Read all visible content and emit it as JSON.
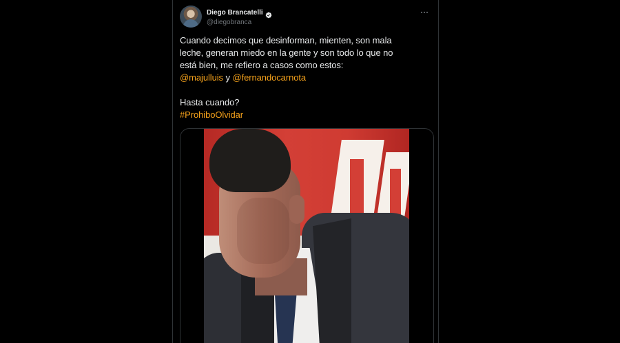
{
  "tweet": {
    "author": {
      "display_name": "Diego Brancatelli",
      "handle": "@diegobranca",
      "verified": true,
      "avatar_icon": "avatar-photo"
    },
    "more_icon": "more-horizontal-icon",
    "text_lines": [
      "Cuando decimos que desinforman, mienten, son mala",
      "leche, generan miedo en la gente y son todo lo que no",
      "está bien, me refiero a casos como estos:"
    ],
    "mentions": {
      "first": "@majulluis",
      "joiner": " y ",
      "second": "@fernandocarnota"
    },
    "question": "Hasta cuando?",
    "hashtag": "#ProhiboOlvidar",
    "media": {
      "type": "video-still",
      "description_label": "video"
    }
  },
  "colors": {
    "background": "#000000",
    "text": "#e7e9ea",
    "muted": "#71767b",
    "accent": "#f4a11b",
    "border": "#2f3336",
    "verified": "#e7e9ea"
  }
}
